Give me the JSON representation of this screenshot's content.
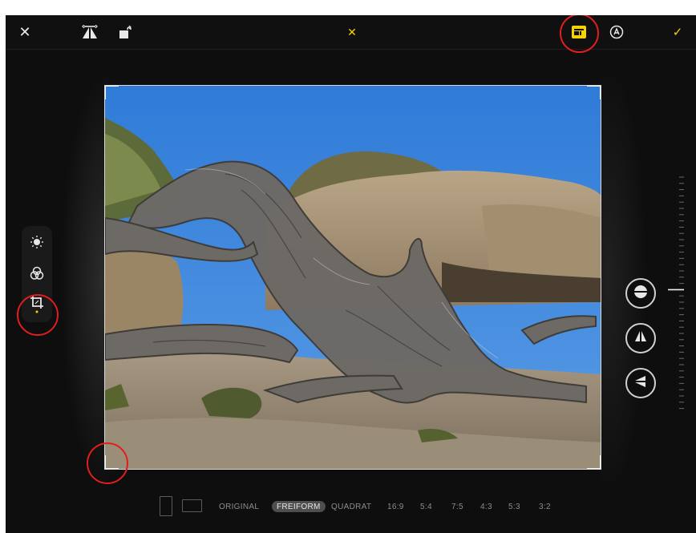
{
  "toolbar": {
    "close_label": "✕",
    "reset_label": "✕",
    "done_label": "✓",
    "icons": [
      "flip-horizontal-icon",
      "rotate-icon",
      "aspect-ratio-icon",
      "markup-icon"
    ],
    "accent_color": "#f5d300",
    "highlight_color": "#e01e1e"
  },
  "sidebar": {
    "items": [
      {
        "icon": "adjust-icon",
        "active": false
      },
      {
        "icon": "filters-icon",
        "active": false
      },
      {
        "icon": "crop-icon",
        "active": true
      }
    ]
  },
  "straighten": {
    "buttons": [
      "straighten-icon",
      "vertical-perspective-icon",
      "horizontal-perspective-icon"
    ]
  },
  "aspect_ratios": {
    "options": [
      "ORIGINAL",
      "FREIFORM",
      "QUADRAT",
      "16:9",
      "5:4",
      "7:5",
      "4:3",
      "5:3",
      "3:2"
    ],
    "selected": "FREIFORM"
  }
}
